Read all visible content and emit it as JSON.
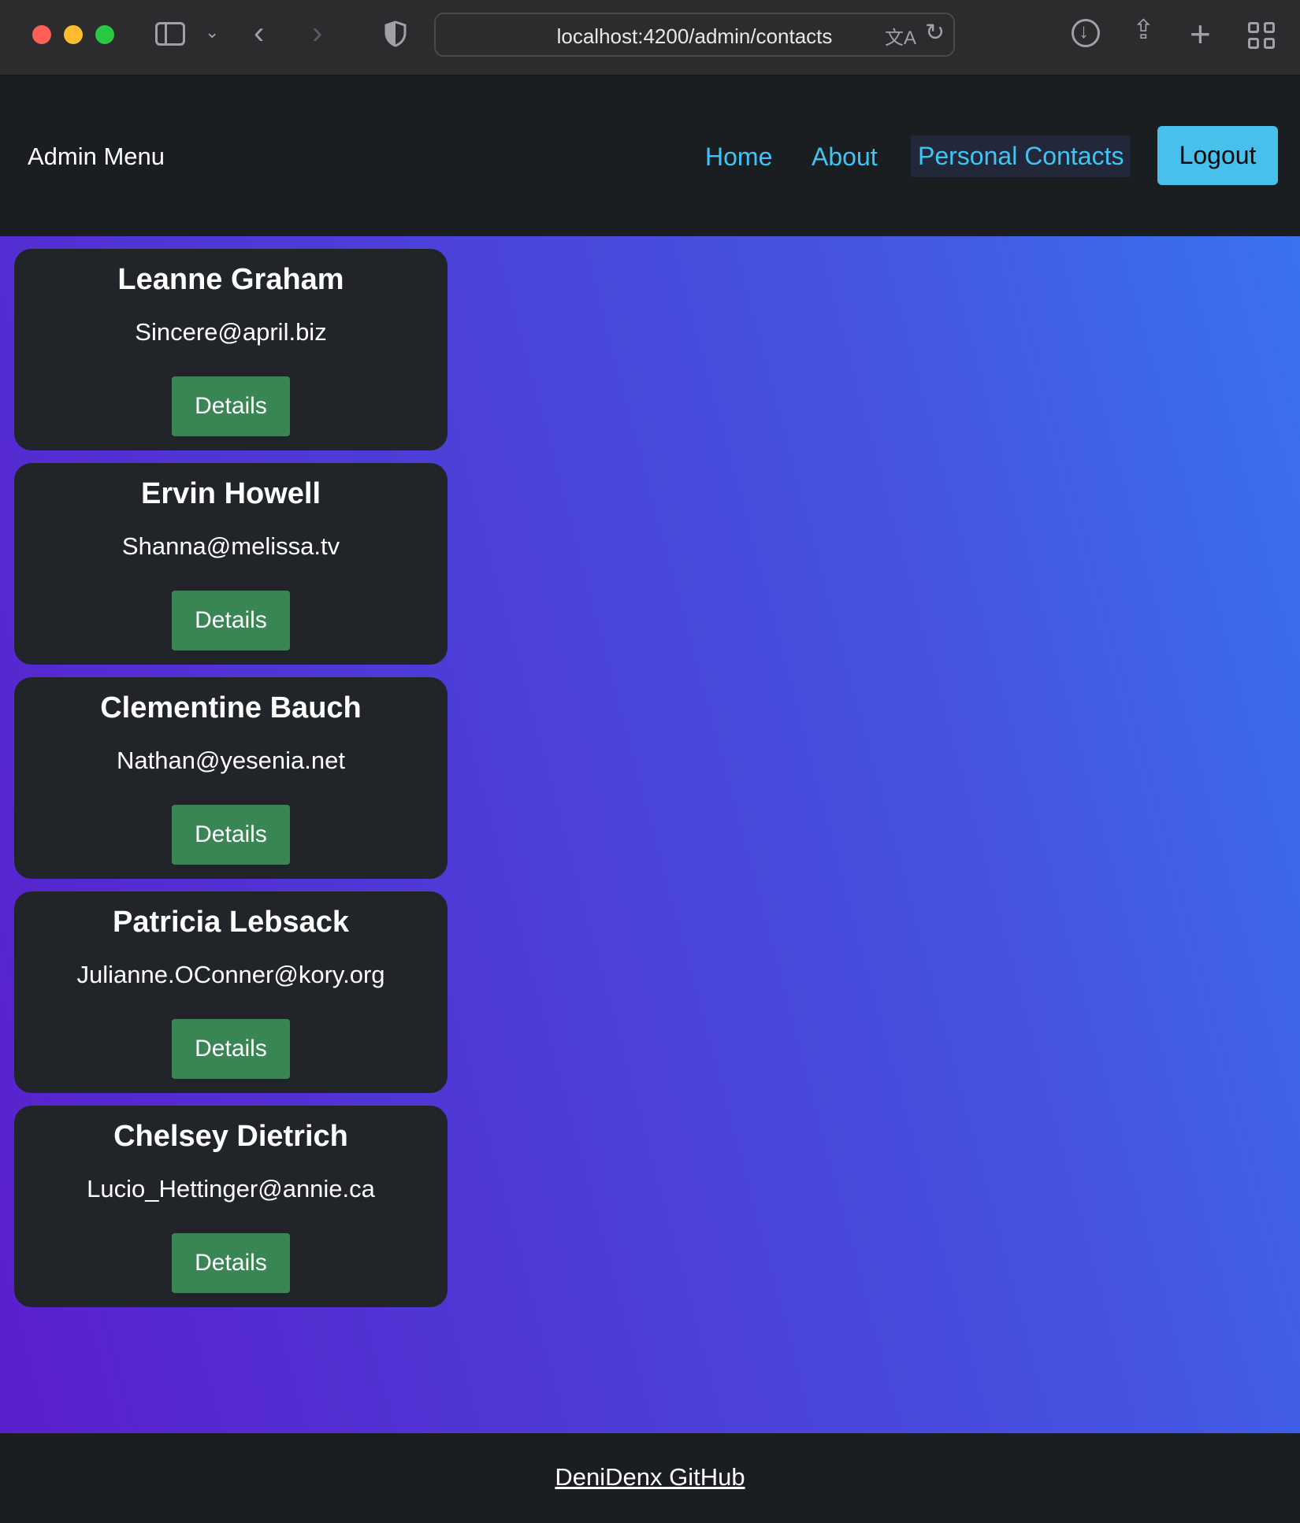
{
  "browser": {
    "url": "localhost:4200/admin/contacts"
  },
  "navbar": {
    "brand": "Admin Menu",
    "links": [
      "Home",
      "About",
      "Personal Contacts"
    ],
    "logout_label": "Logout"
  },
  "contacts": [
    {
      "name": "Leanne Graham",
      "email": "Sincere@april.biz",
      "button": "Details"
    },
    {
      "name": "Ervin Howell",
      "email": "Shanna@melissa.tv",
      "button": "Details"
    },
    {
      "name": "Clementine Bauch",
      "email": "Nathan@yesenia.net",
      "button": "Details"
    },
    {
      "name": "Patricia Lebsack",
      "email": "Julianne.OConner@kory.org",
      "button": "Details"
    },
    {
      "name": "Chelsey Dietrich",
      "email": "Lucio_Hettinger@annie.ca",
      "button": "Details"
    }
  ],
  "footer": {
    "link": "DeniDenx GitHub"
  },
  "colors": {
    "accent_link": "#40c4f5",
    "logout_bg": "#47c0ec",
    "details_bg": "#3a8554",
    "card_bg": "#212529"
  }
}
